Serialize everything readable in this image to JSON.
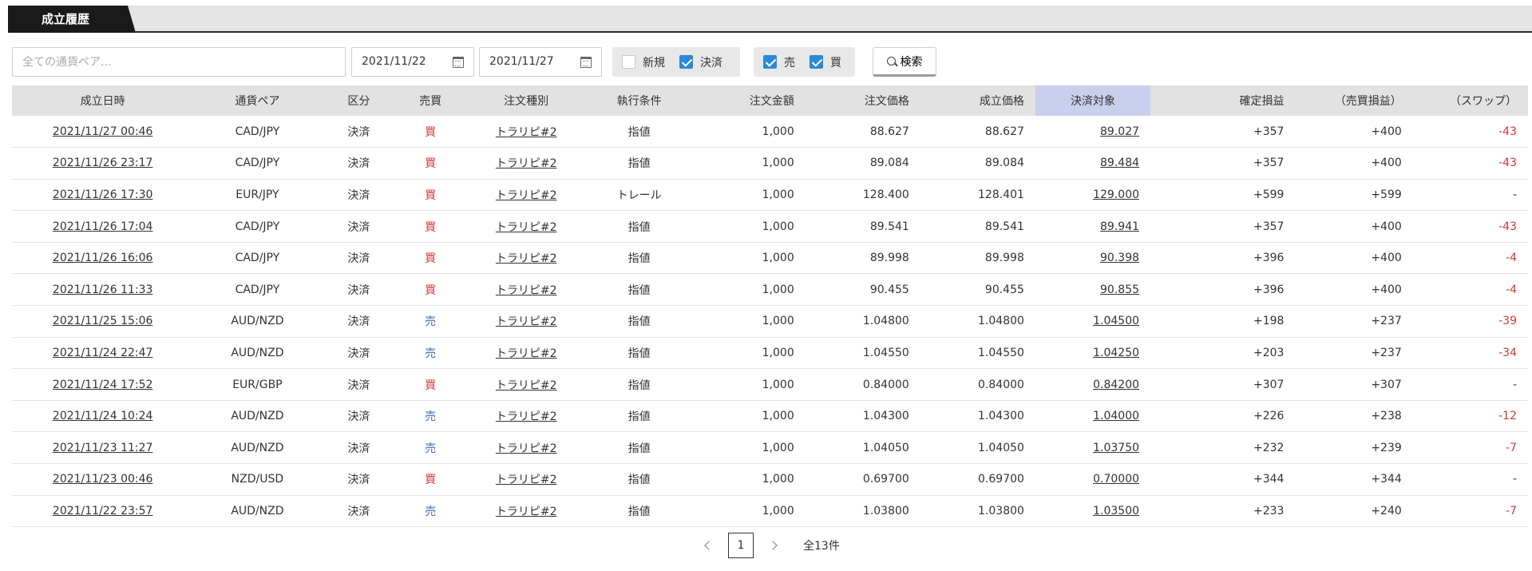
{
  "tab": {
    "label": "成立履歴"
  },
  "filters": {
    "pair_placeholder": "全ての通貨ペア...",
    "date_from": "2021/11/22",
    "date_to": "2021/11/27",
    "kind_new": {
      "label": "新規",
      "checked": false
    },
    "kind_settle": {
      "label": "決済",
      "checked": true
    },
    "side_sell": {
      "label": "売",
      "checked": true
    },
    "side_buy": {
      "label": "買",
      "checked": true
    },
    "search_label": "検索"
  },
  "colors": {
    "buy": "#d0393b",
    "sell": "#3f6fb8",
    "negative": "#d0393b",
    "checkbox": "#2a8ad8",
    "highlight_header": "#c8d0ed"
  },
  "table": {
    "headers": [
      "成立日時",
      "通貨ペア",
      "区分",
      "売買",
      "注文種別",
      "執行条件",
      "注文金額",
      "注文価格",
      "成立価格",
      "決済対象",
      "確定損益",
      "（売買損益）",
      "（スワップ）"
    ],
    "rows": [
      [
        "2021/11/27 00:46",
        "CAD/JPY",
        "決済",
        "買",
        "トラリピ#2",
        "指値",
        "1,000",
        "88.627",
        "88.627",
        "89.027",
        "+357",
        "+400",
        "-43"
      ],
      [
        "2021/11/26 23:17",
        "CAD/JPY",
        "決済",
        "買",
        "トラリピ#2",
        "指値",
        "1,000",
        "89.084",
        "89.084",
        "89.484",
        "+357",
        "+400",
        "-43"
      ],
      [
        "2021/11/26 17:30",
        "EUR/JPY",
        "決済",
        "買",
        "トラリピ#2",
        "トレール",
        "1,000",
        "128.400",
        "128.401",
        "129.000",
        "+599",
        "+599",
        "-"
      ],
      [
        "2021/11/26 17:04",
        "CAD/JPY",
        "決済",
        "買",
        "トラリピ#2",
        "指値",
        "1,000",
        "89.541",
        "89.541",
        "89.941",
        "+357",
        "+400",
        "-43"
      ],
      [
        "2021/11/26 16:06",
        "CAD/JPY",
        "決済",
        "買",
        "トラリピ#2",
        "指値",
        "1,000",
        "89.998",
        "89.998",
        "90.398",
        "+396",
        "+400",
        "-4"
      ],
      [
        "2021/11/26 11:33",
        "CAD/JPY",
        "決済",
        "買",
        "トラリピ#2",
        "指値",
        "1,000",
        "90.455",
        "90.455",
        "90.855",
        "+396",
        "+400",
        "-4"
      ],
      [
        "2021/11/25 15:06",
        "AUD/NZD",
        "決済",
        "売",
        "トラリピ#2",
        "指値",
        "1,000",
        "1.04800",
        "1.04800",
        "1.04500",
        "+198",
        "+237",
        "-39"
      ],
      [
        "2021/11/24 22:47",
        "AUD/NZD",
        "決済",
        "売",
        "トラリピ#2",
        "指値",
        "1,000",
        "1.04550",
        "1.04550",
        "1.04250",
        "+203",
        "+237",
        "-34"
      ],
      [
        "2021/11/24 17:52",
        "EUR/GBP",
        "決済",
        "買",
        "トラリピ#2",
        "指値",
        "1,000",
        "0.84000",
        "0.84000",
        "0.84200",
        "+307",
        "+307",
        "-"
      ],
      [
        "2021/11/24 10:24",
        "AUD/NZD",
        "決済",
        "売",
        "トラリピ#2",
        "指値",
        "1,000",
        "1.04300",
        "1.04300",
        "1.04000",
        "+226",
        "+238",
        "-12"
      ],
      [
        "2021/11/23 11:27",
        "AUD/NZD",
        "決済",
        "売",
        "トラリピ#2",
        "指値",
        "1,000",
        "1.04050",
        "1.04050",
        "1.03750",
        "+232",
        "+239",
        "-7"
      ],
      [
        "2021/11/23 00:46",
        "NZD/USD",
        "決済",
        "買",
        "トラリピ#2",
        "指値",
        "1,000",
        "0.69700",
        "0.69700",
        "0.70000",
        "+344",
        "+344",
        "-"
      ],
      [
        "2021/11/22 23:57",
        "AUD/NZD",
        "決済",
        "売",
        "トラリピ#2",
        "指値",
        "1,000",
        "1.03800",
        "1.03800",
        "1.03500",
        "+233",
        "+240",
        "-7"
      ]
    ]
  },
  "pagination": {
    "current": "1",
    "total": "全13件"
  }
}
